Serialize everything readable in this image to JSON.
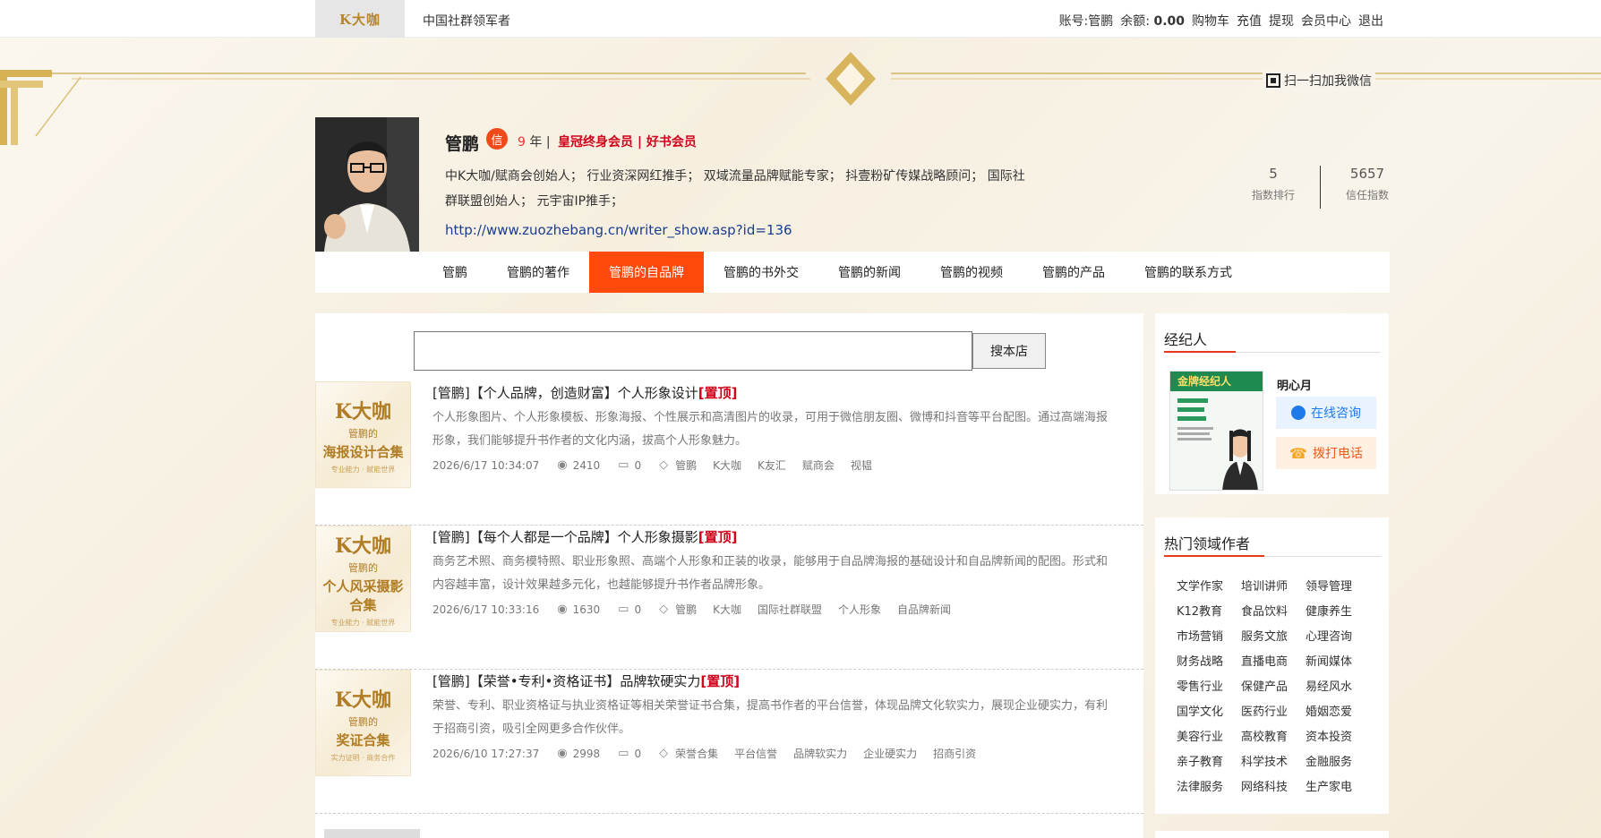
{
  "topbar": {
    "logo": "K大咖",
    "slogan": "中国社群领军者",
    "account_label": "账号:",
    "account_name": "管鹏",
    "balance_label": "余额:",
    "balance_value": "0.00",
    "links": [
      "购物车",
      "充值",
      "提现",
      "会员中心",
      "退出"
    ]
  },
  "qr_button": "扫一扫加我微信",
  "profile": {
    "name": "管鹏",
    "badge": "信",
    "years_num": "9",
    "years_unit": "年",
    "separator": "|",
    "membership": "皇冠终身会员 | 好书会员",
    "bio": "中K大咖/赋商会创始人； 行业资深网红推手； 双域流量品牌赋能专家； 抖壹粉矿传媒战略顾问； 国际社群联盟创始人； 元宇宙IP推手；",
    "url": "http://www.zuozhebang.cn/writer_show.asp?id=136",
    "stats": [
      {
        "value": "5",
        "label": "指数排行"
      },
      {
        "value": "5657",
        "label": "信任指数"
      }
    ]
  },
  "nav": {
    "tabs": [
      "管鹏",
      "管鹏的著作",
      "管鹏的自品牌",
      "管鹏的书外交",
      "管鹏的新闻",
      "管鹏的视频",
      "管鹏的产品",
      "管鹏的联系方式"
    ],
    "active": "管鹏的自品牌"
  },
  "search": {
    "placeholder": "",
    "button": "搜本店"
  },
  "articles": [
    {
      "thumb": {
        "t1": "K大咖",
        "t2": "管鹏的",
        "t3": "海报设计合集",
        "t4": "专业能力 · 赋能世界"
      },
      "title": "[管鹏]【个人品牌，创造财富】个人形象设计",
      "top": "[置顶]",
      "desc": "个人形象图片、个人形象模板、形象海报、个性展示和高清图片的收录，可用于微信朋友圈、微博和抖音等平台配图。通过高端海报形象，我们能够提升书作者的文化内涵，拔高个人形象魅力。",
      "date": "2026/6/17 10:34:07",
      "views": "2410",
      "comments": "0",
      "tags": [
        "管鹏",
        "K大咖",
        "K友汇",
        "赋商会",
        "视韫"
      ]
    },
    {
      "thumb": {
        "t1": "K大咖",
        "t2": "管鹏的",
        "t3": "个人风采摄影合集",
        "t4": "专业能力 · 赋能世界"
      },
      "title": "[管鹏]【每个人都是一个品牌】个人形象摄影",
      "top": "[置顶]",
      "desc": "商务艺术照、商务模特照、职业形象照、高端个人形象和正装的收录，能够用于自品牌海报的基础设计和自品牌新闻的配图。形式和内容越丰富，设计效果越多元化，也越能够提升书作者品牌形象。",
      "date": "2026/6/17 10:33:16",
      "views": "1630",
      "comments": "0",
      "tags": [
        "管鹏",
        "K大咖",
        "国际社群联盟",
        "个人形象",
        "自品牌新闻"
      ]
    },
    {
      "thumb": {
        "t1": "K大咖",
        "t2": "管鹏的",
        "t3": "奖证合集",
        "t4": "实力证明 · 商务合作"
      },
      "title": "[管鹏]【荣誉•专利•资格证书】品牌软硬实力",
      "top": "[置顶]",
      "desc": "荣誉、专利、职业资格证与执业资格证等相关荣誉证书合集，提高书作者的平台信誉，体现品牌文化软实力，展现企业硬实力，有利于招商引资，吸引全网更多合作伙伴。",
      "date": "2026/6/10 17:27:37",
      "views": "2998",
      "comments": "0",
      "tags": [
        "荣誉合集",
        "平台信誉",
        "品牌软实力",
        "企业硬实力",
        "招商引资"
      ]
    }
  ],
  "agent": {
    "title": "经纪人",
    "poster_head": "金牌经纪人",
    "name": "明心月",
    "consult": "在线咨询",
    "call": "拨打电话"
  },
  "hot_fields": {
    "title": "热门领域作者",
    "items": [
      "文学作家",
      "培训讲师",
      "领导管理",
      "K12教育",
      "食品饮料",
      "健康养生",
      "市场营销",
      "服务文旅",
      "心理咨询",
      "财务战略",
      "直播电商",
      "新闻媒体",
      "零售行业",
      "保健产品",
      "易经风水",
      "国学文化",
      "医药行业",
      "婚姻恋爱",
      "美容行业",
      "高校教育",
      "资本投资",
      "亲子教育",
      "科学技术",
      "金融服务",
      "法律服务",
      "网络科技",
      "生产家电"
    ]
  },
  "colors": {
    "accent": "#ff4a0c",
    "vip": "#d0021b",
    "link": "#1a3d8f",
    "gold": "#c9a34a"
  }
}
